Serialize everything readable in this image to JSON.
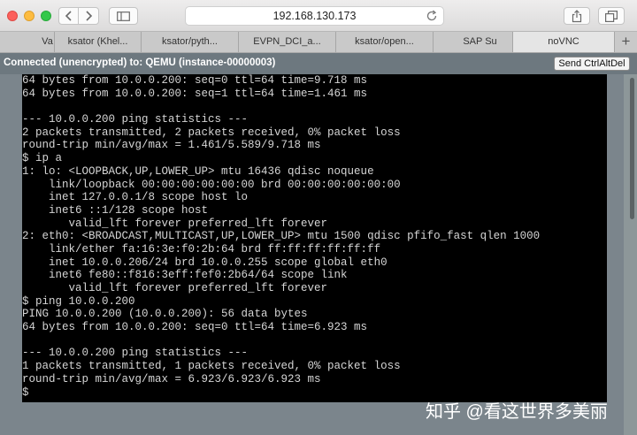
{
  "browser": {
    "url": "192.168.130.173",
    "tabs": [
      {
        "label": "Va"
      },
      {
        "label": "ksator (Khel..."
      },
      {
        "label": "ksator/pyth..."
      },
      {
        "label": "EVPN_DCI_a..."
      },
      {
        "label": "ksator/open..."
      },
      {
        "label": "SAP Su"
      },
      {
        "label": "noVNC"
      }
    ],
    "new_tab_label": "+"
  },
  "novnc": {
    "status": "Connected (unencrypted) to: QEMU (instance-00000003)",
    "send_ctrl_alt_del_label": "Send CtrlAltDel"
  },
  "terminal": {
    "lines": [
      "64 bytes from 10.0.0.200: seq=0 ttl=64 time=9.718 ms",
      "64 bytes from 10.0.0.200: seq=1 ttl=64 time=1.461 ms",
      "",
      "--- 10.0.0.200 ping statistics ---",
      "2 packets transmitted, 2 packets received, 0% packet loss",
      "round-trip min/avg/max = 1.461/5.589/9.718 ms",
      "$ ip a",
      "1: lo: <LOOPBACK,UP,LOWER_UP> mtu 16436 qdisc noqueue",
      "    link/loopback 00:00:00:00:00:00 brd 00:00:00:00:00:00",
      "    inet 127.0.0.1/8 scope host lo",
      "    inet6 ::1/128 scope host",
      "       valid_lft forever preferred_lft forever",
      "2: eth0: <BROADCAST,MULTICAST,UP,LOWER_UP> mtu 1500 qdisc pfifo_fast qlen 1000",
      "    link/ether fa:16:3e:f0:2b:64 brd ff:ff:ff:ff:ff:ff",
      "    inet 10.0.0.206/24 brd 10.0.0.255 scope global eth0",
      "    inet6 fe80::f816:3eff:fef0:2b64/64 scope link",
      "       valid_lft forever preferred_lft forever",
      "$ ping 10.0.0.200",
      "PING 10.0.0.200 (10.0.0.200): 56 data bytes",
      "64 bytes from 10.0.0.200: seq=0 ttl=64 time=6.923 ms",
      "",
      "--- 10.0.0.200 ping statistics ---",
      "1 packets transmitted, 1 packets received, 0% packet loss",
      "round-trip min/avg/max = 6.923/6.923/6.923 ms",
      "$"
    ]
  },
  "watermark": "知乎 @看这世界多美丽",
  "colors": {
    "novnc_bar": "#6d787f",
    "terminal_bg": "#000000",
    "terminal_text": "#d5d5d5"
  },
  "icons": [
    "back-icon",
    "forward-icon",
    "sidebar-icon",
    "reload-icon",
    "share-icon",
    "tabs-icon"
  ]
}
